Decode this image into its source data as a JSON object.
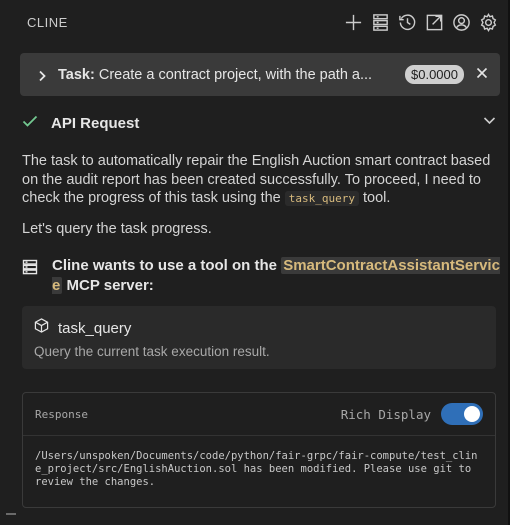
{
  "header": {
    "title": "CLINE",
    "icons": [
      "plus-icon",
      "server-stack-icon",
      "history-icon",
      "popout-icon",
      "account-icon",
      "settings-icon"
    ]
  },
  "task": {
    "label": "Task:",
    "text": "Create a contract project, with the path a...",
    "cost": "$0.0000"
  },
  "api_request": {
    "label": "API Request",
    "status_color": "#73c991"
  },
  "message": {
    "para1_before": "The task to automatically repair the English Auction smart contract based on the audit report has been created successfully. To proceed, I need to check the progress of this task using the ",
    "para1_code": "task_query",
    "para1_after": " tool.",
    "para2": "Let's query the task progress."
  },
  "mcp": {
    "prefix": "Cline wants to use a tool on the ",
    "server_name": "SmartContractAssistantService",
    "suffix": " MCP server:"
  },
  "tool": {
    "name": "task_query",
    "description": "Query the current task execution result."
  },
  "response": {
    "label": "Response",
    "rich_display_label": "Rich Display",
    "rich_display_enabled": true,
    "text": "/Users/unspoken/Documents/code/python/fair-grpc/fair-compute/test_cline_project/src/EnglishAuction.sol has been modified. Please use git to review the changes."
  },
  "colors": {
    "background": "#1f1f1f",
    "accent": "#2f6fb8",
    "code": "#d7ba7d"
  }
}
